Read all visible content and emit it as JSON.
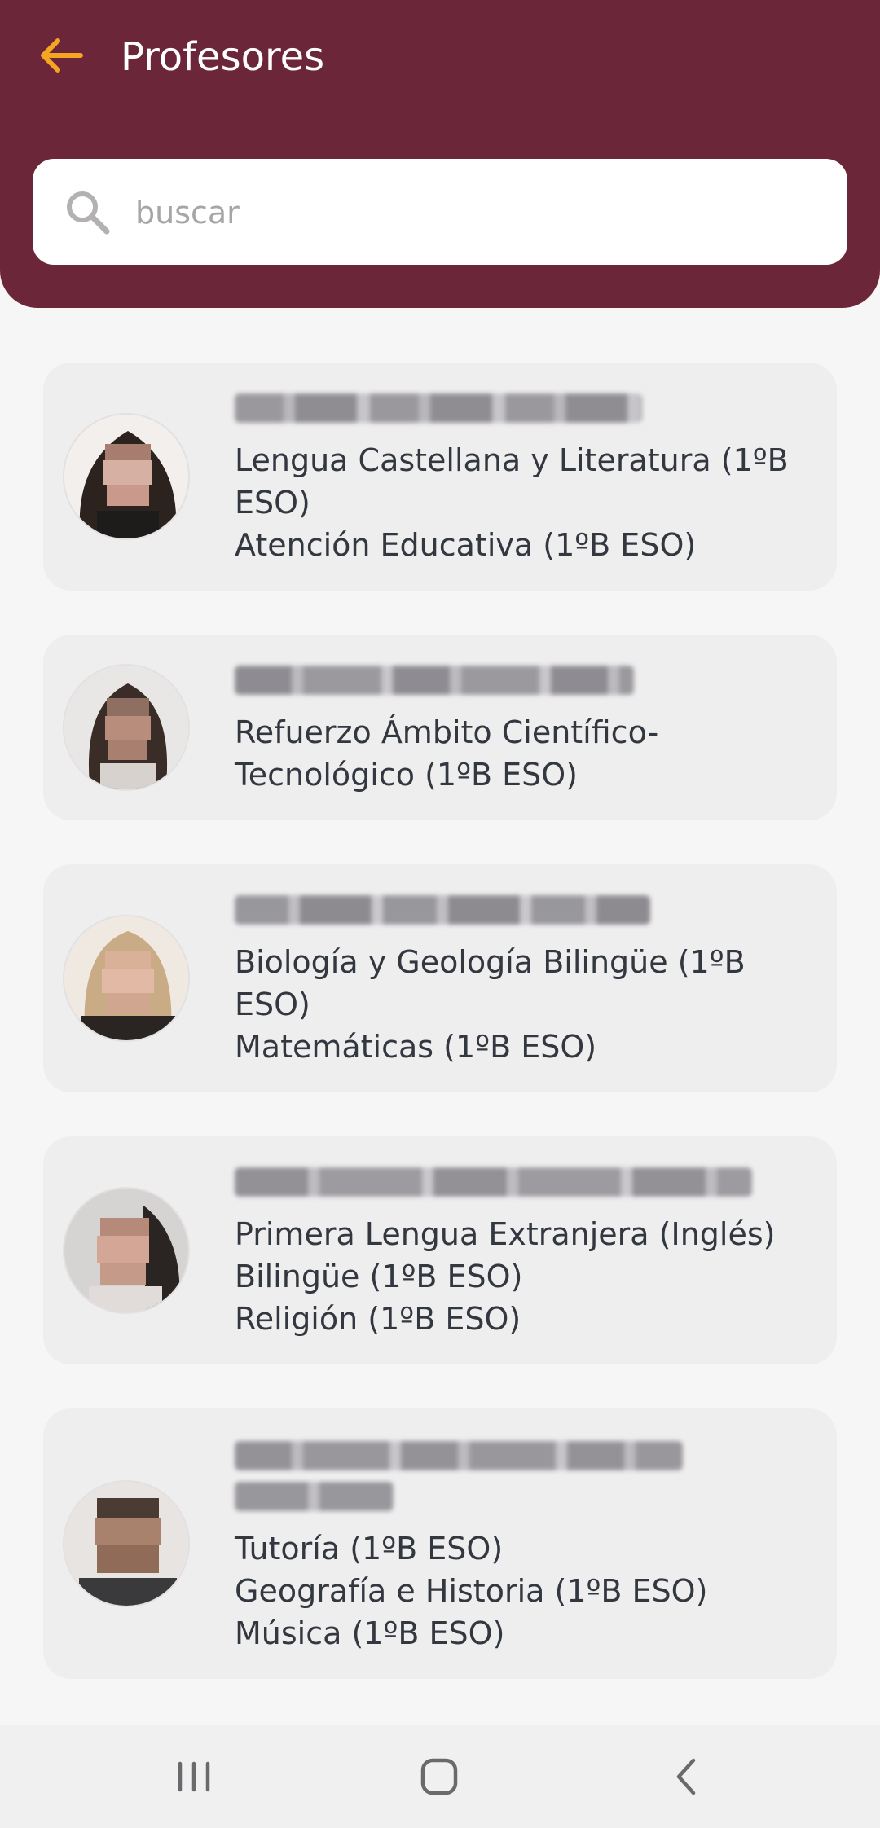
{
  "header": {
    "title": "Profesores",
    "back_icon": "arrow-left-icon",
    "background": "#6b263a",
    "back_color": "#f4a623"
  },
  "search": {
    "placeholder": "buscar",
    "icon": "search-icon"
  },
  "teachers": [
    {
      "subjects": [
        "Lengua Castellana y Literatura (1ºB ESO)",
        "Atención Educativa (1ºB ESO)"
      ]
    },
    {
      "subjects": [
        "Refuerzo Ámbito Científico-Tecnológico (1ºB ESO)"
      ]
    },
    {
      "subjects": [
        "Biología y Geología Bilingüe (1ºB ESO)",
        "Matemáticas (1ºB ESO)"
      ]
    },
    {
      "subjects": [
        "Primera Lengua Extranjera (Inglés) Bilingüe (1ºB ESO)",
        "Religión (1ºB ESO)"
      ]
    },
    {
      "subjects": [
        "Tutoría (1ºB ESO)",
        "Geografía e Historia (1ºB ESO)",
        "Música (1ºB ESO)"
      ]
    }
  ],
  "navbar": {
    "recents_icon": "recent-apps-icon",
    "home_icon": "home-icon",
    "back_icon": "back-chevron-icon"
  }
}
